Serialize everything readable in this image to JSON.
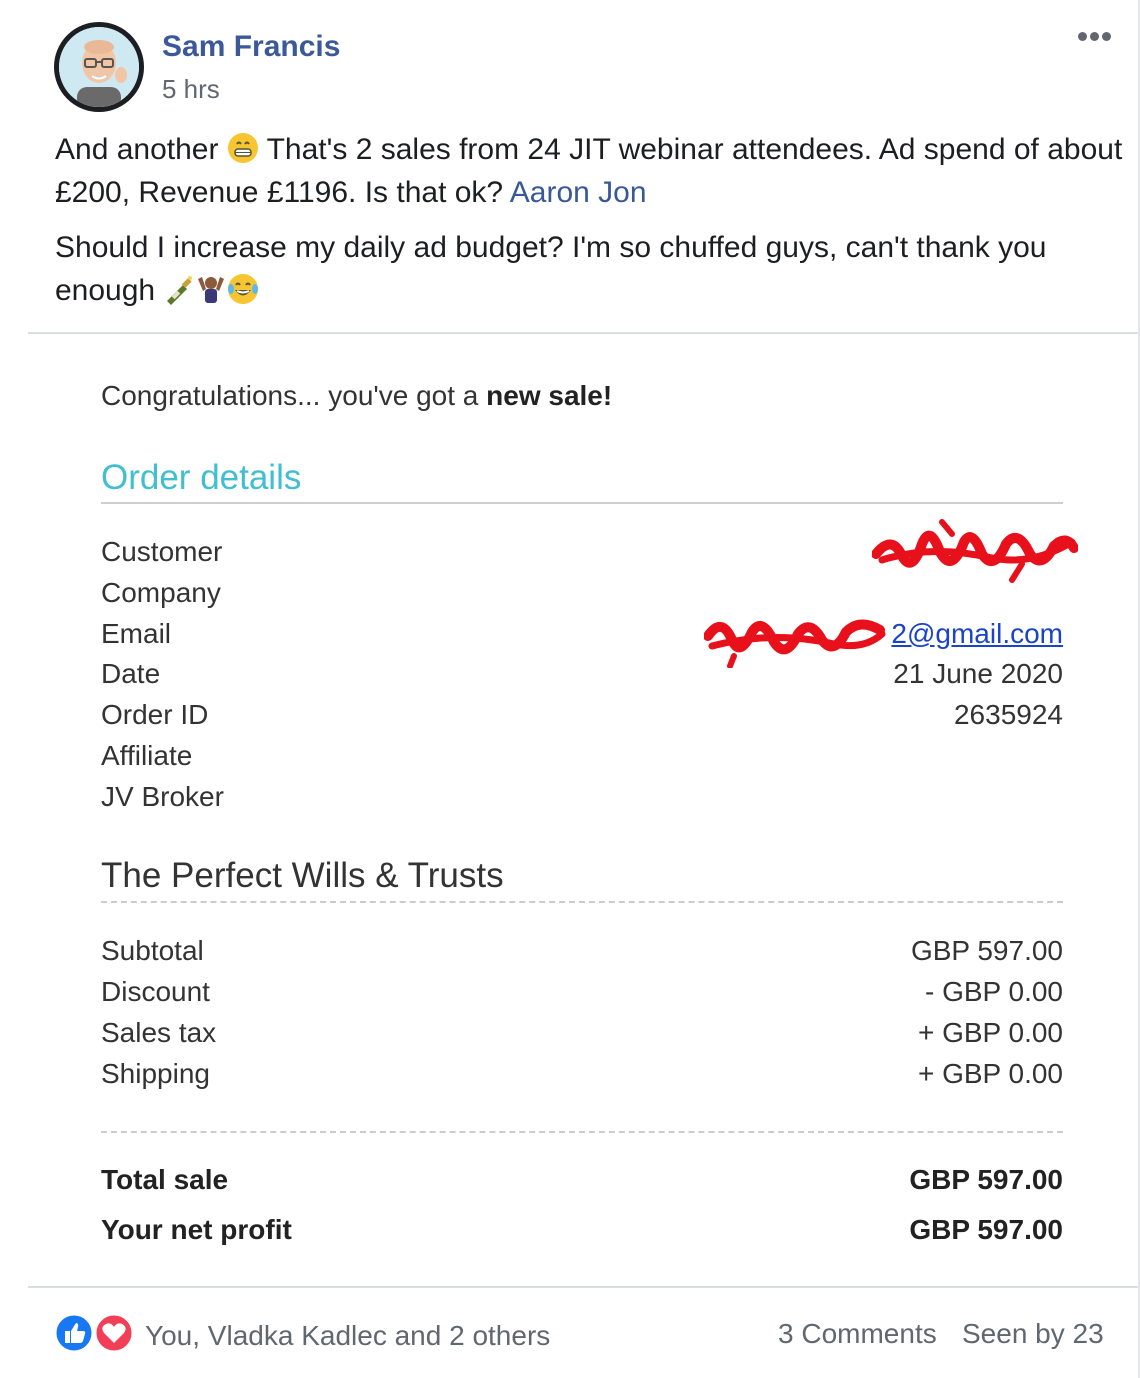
{
  "post": {
    "author": "Sam Francis",
    "time": "5 hrs",
    "paragraph1_a": "And another",
    "paragraph1_b": " That's 2 sales from 24 JIT webinar attendees. Ad spend of about £200, Revenue £1196. Is that ok? ",
    "mention": "Aaron Jon",
    "paragraph2": "Should I increase my daily ad budget? I'm so chuffed guys, can't thank you enough"
  },
  "email": {
    "congrats_text": "Congratulations... you've got a ",
    "congrats_bold": "new sale!",
    "order_title": "Order details",
    "details": [
      {
        "label": "Customer",
        "value": ""
      },
      {
        "label": "Company",
        "value": ""
      },
      {
        "label": "Email",
        "value": "2@gmail.com"
      },
      {
        "label": "Date",
        "value": "21 June 2020"
      },
      {
        "label": "Order ID",
        "value": "2635924"
      },
      {
        "label": "Affiliate",
        "value": ""
      },
      {
        "label": "JV Broker",
        "value": ""
      }
    ],
    "product": "The Perfect Wills & Trusts",
    "totals": [
      {
        "label": "Subtotal",
        "value": "GBP 597.00"
      },
      {
        "label": "Discount",
        "value": "- GBP 0.00"
      },
      {
        "label": "Sales tax",
        "value": "+ GBP 0.00"
      },
      {
        "label": "Shipping",
        "value": "+ GBP 0.00"
      }
    ],
    "total_sale_label": "Total sale",
    "total_sale_value": "GBP 597.00",
    "net_profit_label": "Your net profit",
    "net_profit_value": "GBP 597.00"
  },
  "footer": {
    "reactors": "You, Vladka Kadlec and 2 others",
    "comments": "3 Comments",
    "seen": "Seen by 23"
  },
  "colors": {
    "author": "#3b5998",
    "order_title": "#3fbfcf",
    "link": "#1a44c8",
    "like_blue": "#1877f2",
    "love_red": "#f33e58",
    "redaction": "#e8101a"
  },
  "icons": [
    "more-icon",
    "grin-emoji",
    "bottle-emoji",
    "flexing-emoji",
    "tears-of-joy-emoji",
    "like-icon",
    "love-icon"
  ]
}
